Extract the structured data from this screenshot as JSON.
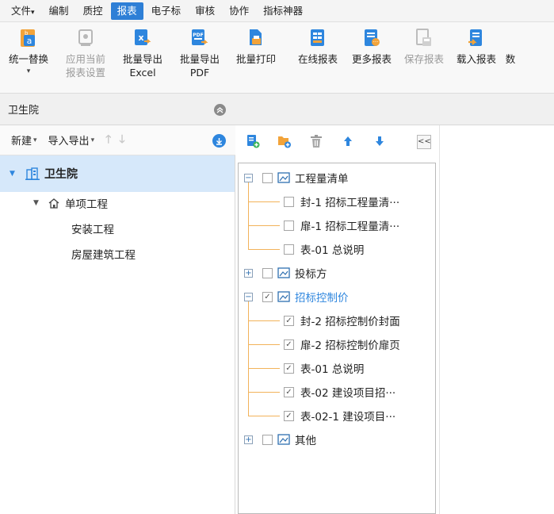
{
  "menu": [
    {
      "label": "文件",
      "dropdown": true
    },
    {
      "label": "编制"
    },
    {
      "label": "质控"
    },
    {
      "label": "报表",
      "active": true
    },
    {
      "label": "电子标"
    },
    {
      "label": "审核"
    },
    {
      "label": "协作"
    },
    {
      "label": "指标神器"
    }
  ],
  "ribbon": {
    "unify_replace": "统一替换",
    "apply_current_line1": "应用当前",
    "apply_current_line2": "报表设置",
    "export_excel_line1": "批量导出",
    "export_excel_line2": "Excel",
    "export_pdf_line1": "批量导出",
    "export_pdf_line2": "PDF",
    "batch_print": "批量打印",
    "online_report": "在线报表",
    "more_reports": "更多报表",
    "save_report": "保存报表",
    "load_report": "载入报表",
    "truncated": "数"
  },
  "left_panel": {
    "title": "卫生院",
    "new_label": "新建",
    "import_export_label": "导入导出",
    "root": "卫生院",
    "single_project": "单项工程",
    "child1": "安装工程",
    "child2": "房屋建筑工程"
  },
  "report_tree": {
    "g1": "工程量清单",
    "g1_i1": "封-1 招标工程量清···",
    "g1_i2": "扉-1 招标工程量清···",
    "g1_i3": "表-01 总说明",
    "g2": "投标方",
    "g3": "招标控制价",
    "g3_i1": "封-2 招标控制价封面",
    "g3_i2": "扉-2 招标控制价扉页",
    "g3_i3": "表-01 总说明",
    "g3_i4": "表-02 建设项目招···",
    "g3_i5": "表-02-1 建设项目···",
    "g4": "其他",
    "collapse": "<<"
  },
  "colors": {
    "accent": "#2e7fd6",
    "selected_row": "#d6e8fa",
    "tree_line": "#f2b35a",
    "active_text": "#2e86de"
  }
}
